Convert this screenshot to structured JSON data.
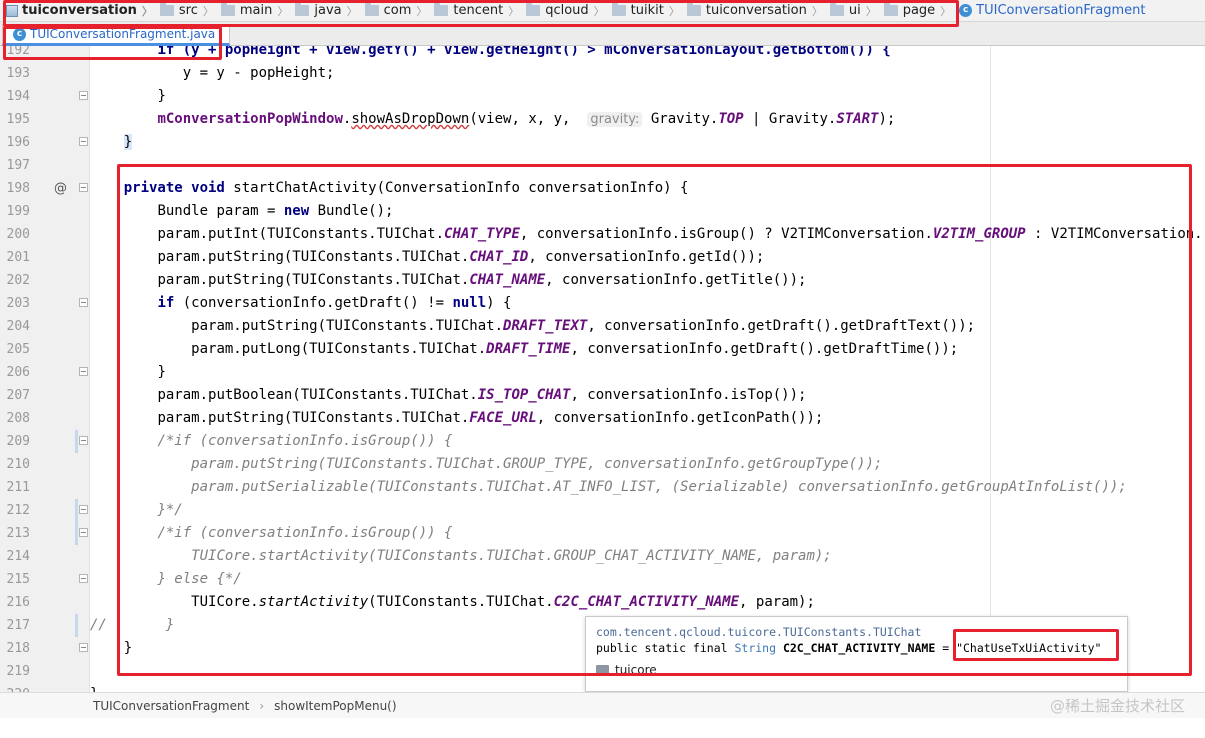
{
  "breadcrumb": {
    "items": [
      {
        "label": "tuiconversation",
        "icon": "module-icon",
        "root": true
      },
      {
        "label": "src",
        "icon": "folder-icon"
      },
      {
        "label": "main",
        "icon": "folder-icon"
      },
      {
        "label": "java",
        "icon": "folder-icon"
      },
      {
        "label": "com",
        "icon": "folder-icon"
      },
      {
        "label": "tencent",
        "icon": "folder-icon"
      },
      {
        "label": "qcloud",
        "icon": "folder-icon"
      },
      {
        "label": "tuikit",
        "icon": "folder-icon"
      },
      {
        "label": "tuiconversation",
        "icon": "folder-icon"
      },
      {
        "label": "ui",
        "icon": "folder-icon"
      },
      {
        "label": "page",
        "icon": "folder-icon"
      },
      {
        "label": "TUIConversationFragment",
        "icon": "class-icon",
        "active": true
      }
    ]
  },
  "tab": {
    "label": "TUIConversationFragment.java",
    "icon_letter": "c"
  },
  "gutter": {
    "line_numbers": [
      "192",
      "193",
      "194",
      "195",
      "196",
      "197",
      "198",
      "199",
      "200",
      "201",
      "202",
      "203",
      "204",
      "205",
      "206",
      "207",
      "208",
      "209",
      "210",
      "211",
      "212",
      "213",
      "214",
      "215",
      "216",
      "217",
      "218",
      "219",
      "220"
    ],
    "override_marker": "@",
    "comment_prefix": "//"
  },
  "code": {
    "l192": "if (y + popHeight + view.getY() + view.getHeight() > mConversationLayout.getBottom()) {",
    "l193a": "y = y - popHeight;",
    "l194": "}",
    "l195_obj": "mConversationPopWindow",
    "l195_method": "showAsDropDown",
    "l195_args": "(view, x, y,",
    "l195_hint": "gravity:",
    "l195_rest_a": "Gravity.",
    "l195_top": "TOP",
    "l195_pipe": " | Gravity.",
    "l195_start": "START",
    "l195_end": ");",
    "l196": "}",
    "l198_kw": "private void",
    "l198_rest": " startChatActivity(ConversationInfo conversationInfo) {",
    "l199_a": "Bundle param = ",
    "l199_kw": "new",
    "l199_b": " Bundle();",
    "l200_a": "param.putInt(TUIConstants.TUIChat.",
    "l200_f": "CHAT_TYPE",
    "l200_b": ", conversationInfo.isGroup() ? V2TIMConversation.",
    "l200_g": "V2TIM_GROUP",
    "l200_c": " : V2TIMConversation.",
    "l201_a": "param.putString(TUIConstants.TUIChat.",
    "l201_f": "CHAT_ID",
    "l201_b": ", conversationInfo.getId());",
    "l202_a": "param.putString(TUIConstants.TUIChat.",
    "l202_f": "CHAT_NAME",
    "l202_b": ", conversationInfo.getTitle());",
    "l203_kw": "if",
    "l203_a": " (conversationInfo.getDraft() != ",
    "l203_null": "null",
    "l203_b": ") {",
    "l204_a": "param.putString(TUIConstants.TUIChat.",
    "l204_f": "DRAFT_TEXT",
    "l204_b": ", conversationInfo.getDraft().getDraftText());",
    "l205_a": "param.putLong(TUIConstants.TUIChat.",
    "l205_f": "DRAFT_TIME",
    "l205_b": ", conversationInfo.getDraft().getDraftTime());",
    "l206": "}",
    "l207_a": "param.putBoolean(TUIConstants.TUIChat.",
    "l207_f": "IS_TOP_CHAT",
    "l207_b": ", conversationInfo.isTop());",
    "l208_a": "param.putString(TUIConstants.TUIChat.",
    "l208_f": "FACE_URL",
    "l208_b": ", conversationInfo.getIconPath());",
    "l209": "/*if (conversationInfo.isGroup()) {",
    "l210": "param.putString(TUIConstants.TUIChat.GROUP_TYPE, conversationInfo.getGroupType());",
    "l211": "param.putSerializable(TUIConstants.TUIChat.AT_INFO_LIST, (Serializable) conversationInfo.getGroupAtInfoList());",
    "l212": "}*/",
    "l213": "/*if (conversationInfo.isGroup()) {",
    "l214": "TUICore.startActivity(TUIConstants.TUIChat.GROUP_CHAT_ACTIVITY_NAME, param);",
    "l215": "} else {*/",
    "l216_a": "TUICore.",
    "l216_m": "startActivity",
    "l216_b": "(TUIConstants.TUIChat.",
    "l216_f": "C2C_CHAT_ACTIVITY_NAME",
    "l216_c": ", param);",
    "l217": "}",
    "l218": "}",
    "l220": "}"
  },
  "popup": {
    "fqname": "com.tencent.qcloud.tuicore.TUIConstants.TUIChat",
    "sig_mod": "public static final ",
    "sig_type": "String",
    "sig_name": " C2C_CHAT_ACTIVITY_NAME",
    "sig_eq": " = ",
    "sig_value": "\"ChatUseTxUiActivity\"",
    "module": "tuicore"
  },
  "bottombar": {
    "class_name": "TUIConversationFragment",
    "method_name": "showItemPopMenu()"
  },
  "watermark": "@稀土掘金技术社区",
  "colors": {
    "annotation": "#e5212d",
    "keyword": "#000080",
    "constant": "#660e7a",
    "comment": "#808080"
  }
}
